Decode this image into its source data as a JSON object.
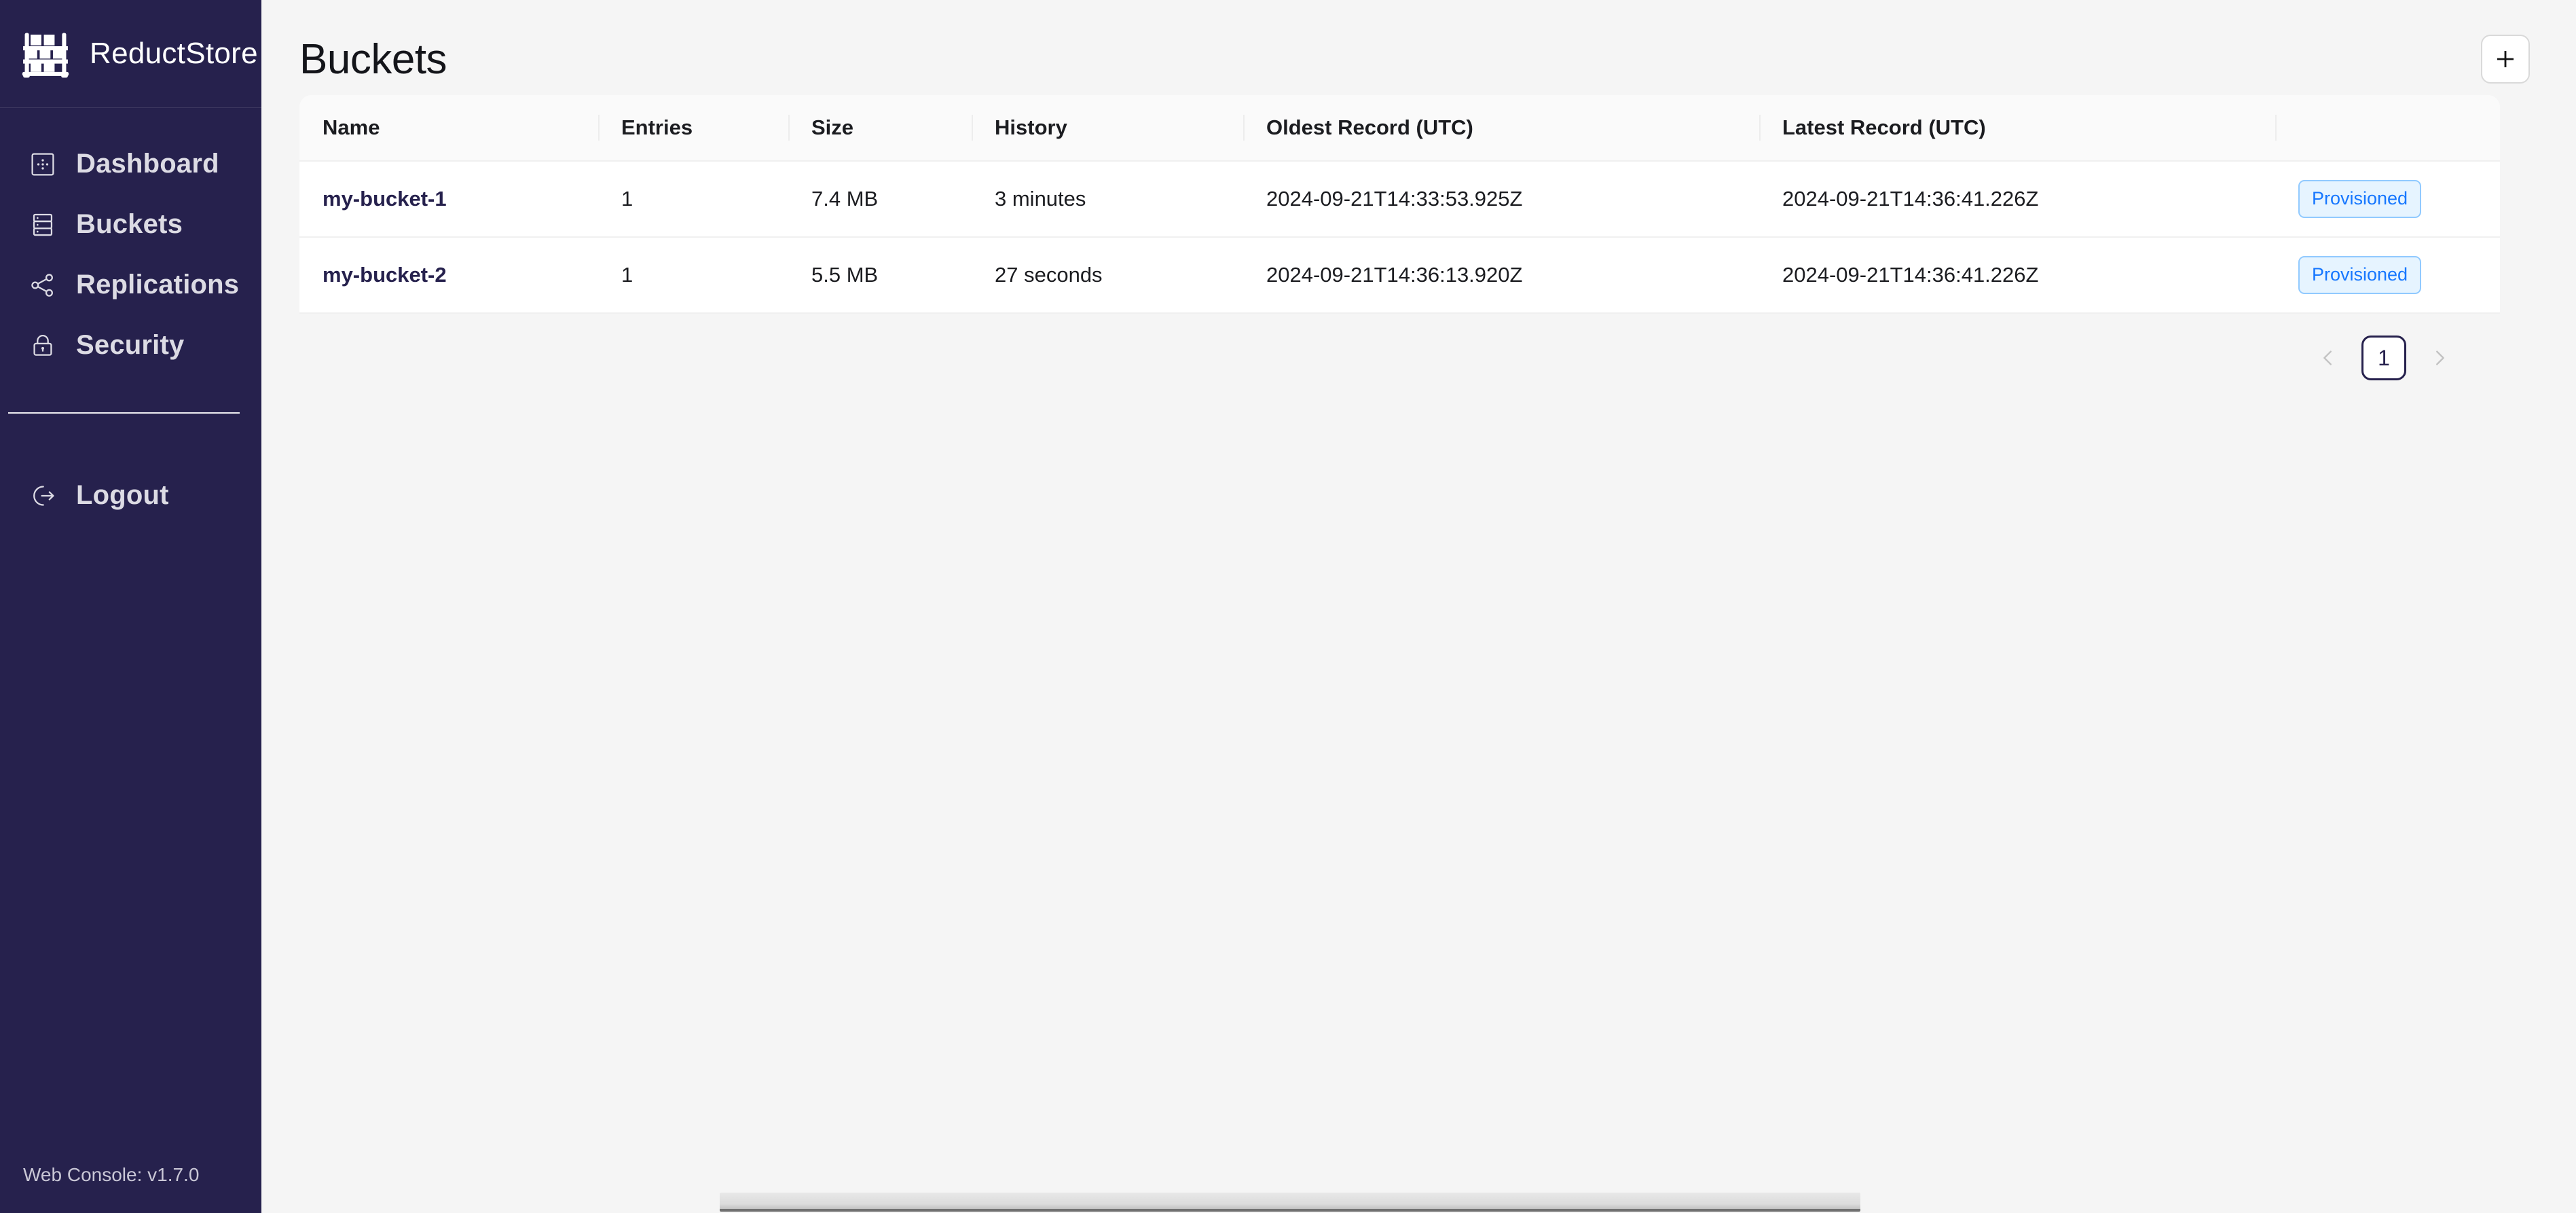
{
  "brand": {
    "name": "ReductStore",
    "logo_icon": "shelf-rack-icon"
  },
  "sidebar": {
    "items": [
      {
        "label": "Dashboard",
        "icon": "dashboard-icon"
      },
      {
        "label": "Buckets",
        "icon": "database-icon"
      },
      {
        "label": "Replications",
        "icon": "share-nodes-icon"
      },
      {
        "label": "Security",
        "icon": "lock-icon"
      }
    ],
    "logout": {
      "label": "Logout",
      "icon": "logout-icon"
    },
    "version": "Web Console: v1.7.0"
  },
  "header": {
    "title": "Buckets",
    "add_icon": "plus-icon"
  },
  "table": {
    "columns": [
      "Name",
      "Entries",
      "Size",
      "History",
      "Oldest Record (UTC)",
      "Latest Record (UTC)",
      ""
    ],
    "rows": [
      {
        "name": "my-bucket-1",
        "entries": "1",
        "size": "7.4 MB",
        "history": "3 minutes",
        "oldest": "2024-09-21T14:33:53.925Z",
        "latest": "2024-09-21T14:36:41.226Z",
        "status": "Provisioned"
      },
      {
        "name": "my-bucket-2",
        "entries": "1",
        "size": "5.5 MB",
        "history": "27 seconds",
        "oldest": "2024-09-21T14:36:13.920Z",
        "latest": "2024-09-21T14:36:41.226Z",
        "status": "Provisioned"
      }
    ]
  },
  "pagination": {
    "prev_icon": "chevron-left-icon",
    "next_icon": "chevron-right-icon",
    "current_page": "1"
  },
  "colors": {
    "sidebar_bg": "#26214d",
    "accent_navy": "#26214d",
    "badge_bg": "#e6f4ff",
    "badge_border": "#91caff",
    "badge_text": "#1677ff",
    "page_bg": "#f5f5f5"
  }
}
